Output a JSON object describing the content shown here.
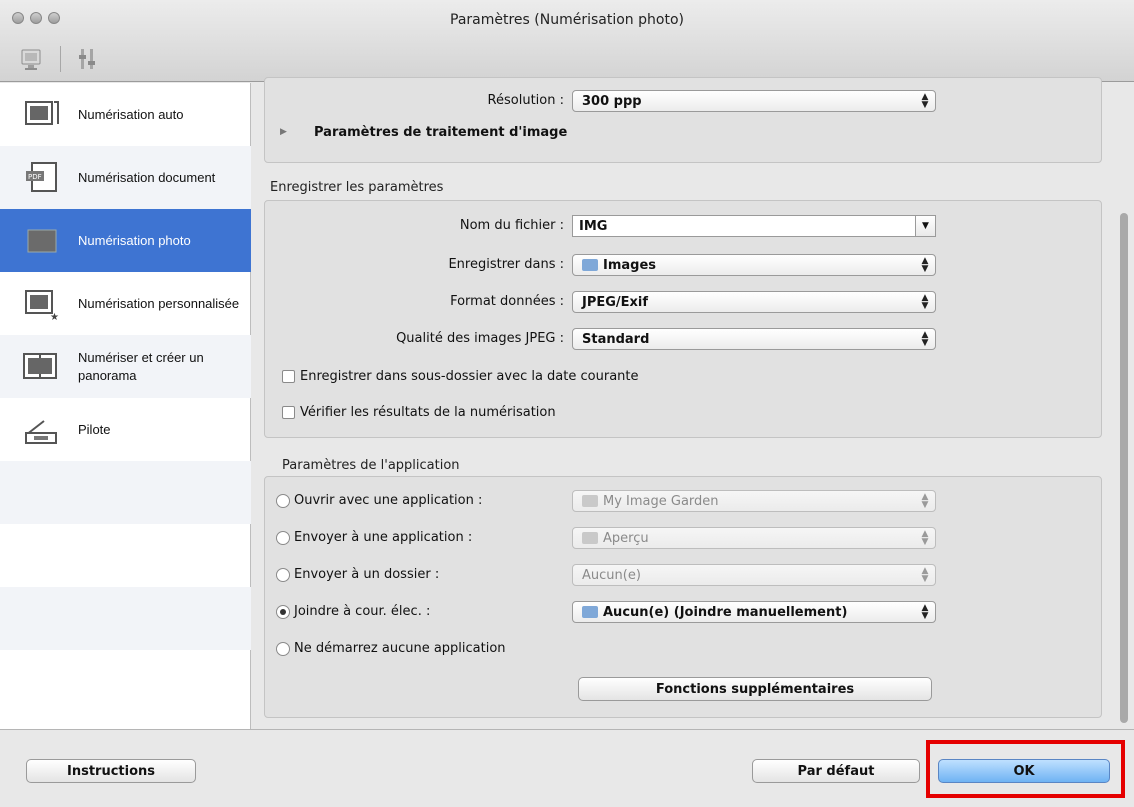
{
  "window": {
    "title": "Paramètres (Numérisation photo)"
  },
  "sidebar": {
    "items": [
      {
        "label": "Numérisation auto",
        "icon": "auto-scan-icon"
      },
      {
        "label": "Numérisation document",
        "icon": "document-scan-icon"
      },
      {
        "label": "Numérisation photo",
        "icon": "photo-scan-icon",
        "selected": true
      },
      {
        "label": "Numérisation personnalisée",
        "icon": "custom-scan-icon"
      },
      {
        "label": "Numériser et créer un panorama",
        "icon": "panorama-icon"
      },
      {
        "label": "Pilote",
        "icon": "driver-icon"
      }
    ]
  },
  "scan_options": {
    "resolution_label": "Résolution :",
    "resolution_value": "300 ppp",
    "image_processing_label": "Paramètres de traitement d'image"
  },
  "save_settings": {
    "title": "Enregistrer les paramètres",
    "filename_label": "Nom du fichier :",
    "filename_value": "IMG",
    "save_in_label": "Enregistrer dans :",
    "save_in_value": "Images",
    "format_label": "Format données :",
    "format_value": "JPEG/Exif",
    "jpeg_quality_label": "Qualité des images JPEG :",
    "jpeg_quality_value": "Standard",
    "subfolder_checkbox": "Enregistrer dans sous-dossier avec la date courante",
    "verify_checkbox": "Vérifier les résultats de la numérisation"
  },
  "app_settings": {
    "title": "Paramètres de l'application",
    "open_with_label": "Ouvrir avec une application :",
    "open_with_value": "My Image Garden",
    "send_app_label": "Envoyer à une application :",
    "send_app_value": "Aperçu",
    "send_folder_label": "Envoyer à un dossier :",
    "send_folder_value": "Aucun(e)",
    "email_label": "Joindre à cour. élec. :",
    "email_value": "Aucun(e) (Joindre manuellement)",
    "none_label": "Ne démarrez aucune application",
    "more_functions": "Fonctions supplémentaires"
  },
  "footer": {
    "instructions": "Instructions",
    "defaults": "Par défaut",
    "ok": "OK"
  },
  "colors": {
    "selection": "#3e74d2",
    "highlight": "#e50000",
    "default_button": "#6fb3f3"
  }
}
